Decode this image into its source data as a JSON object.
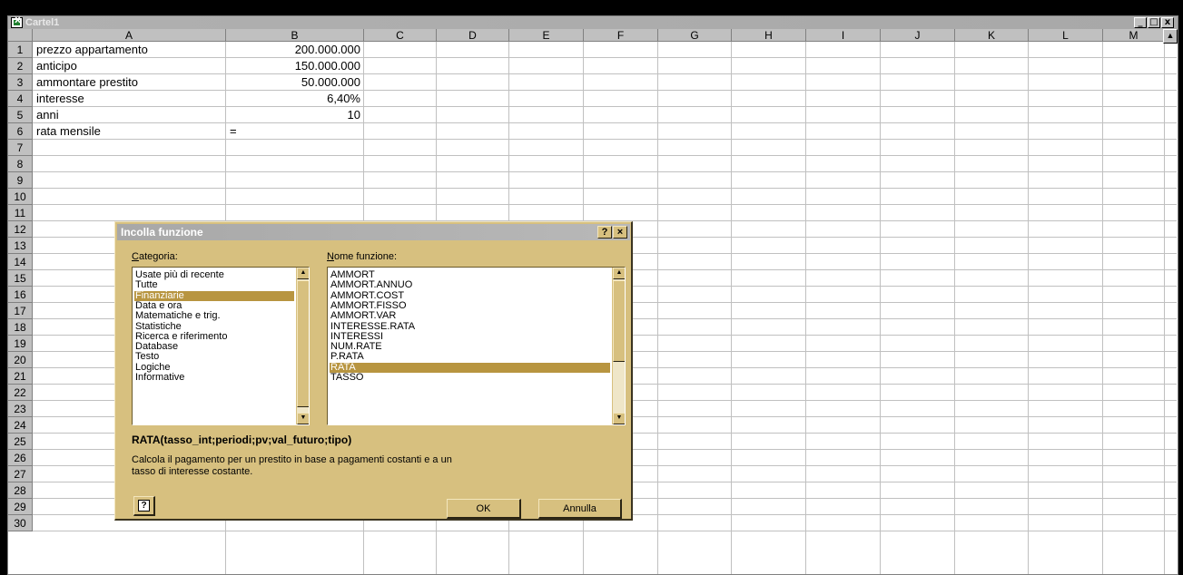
{
  "window": {
    "title": "Cartel1",
    "min": "_",
    "max": "□",
    "close": "x"
  },
  "columns": [
    "A",
    "B",
    "C",
    "D",
    "E",
    "F",
    "G",
    "H",
    "I",
    "J",
    "K",
    "L",
    "M"
  ],
  "rows": [
    "1",
    "2",
    "3",
    "4",
    "5",
    "6",
    "7",
    "8",
    "9",
    "10",
    "11",
    "12",
    "13",
    "14",
    "15",
    "16",
    "17",
    "18",
    "19",
    "20",
    "21",
    "22",
    "23",
    "24",
    "25",
    "26",
    "27",
    "28",
    "29",
    "30"
  ],
  "cells": {
    "A1": "prezzo appartamento",
    "B1": "200.000.000",
    "A2": "anticipo",
    "B2": "150.000.000",
    "A3": "ammontare prestito",
    "B3": "50.000.000",
    "A4": "interesse",
    "B4": "6,40%",
    "A5": "anni",
    "B5": "10",
    "A6": "rata mensile",
    "B6": "="
  },
  "dialog": {
    "title": "Incolla funzione",
    "help_glyph": "?",
    "close_glyph": "×",
    "category_label": "Categoria:",
    "function_label": "Nome funzione:",
    "categories": [
      "Usate più di recente",
      "Tutte",
      "Finanziarie",
      "Data e ora",
      "Matematiche e trig.",
      "Statistiche",
      "Ricerca e riferimento",
      "Database",
      "Testo",
      "Logiche",
      "Informative"
    ],
    "selected_category": "Finanziarie",
    "functions": [
      "AMMORT",
      "AMMORT.ANNUO",
      "AMMORT.COST",
      "AMMORT.FISSO",
      "AMMORT.VAR",
      "INTERESSE.RATA",
      "INTERESSI",
      "NUM.RATE",
      "P.RATA",
      "RATA",
      "TASSO"
    ],
    "selected_function": "RATA",
    "syntax": "RATA(tasso_int;periodi;pv;val_futuro;tipo)",
    "description_line1": "Calcola il pagamento per un prestito in base a pagamenti costanti e a un",
    "description_line2": "tasso di interesse costante.",
    "ok_label": "OK",
    "cancel_label": "Annulla",
    "help_button_glyph": "?"
  },
  "colors": {
    "dialog_bg": "#d7c07f",
    "selection": "#b89540",
    "header_gray": "#c0c0c0"
  }
}
